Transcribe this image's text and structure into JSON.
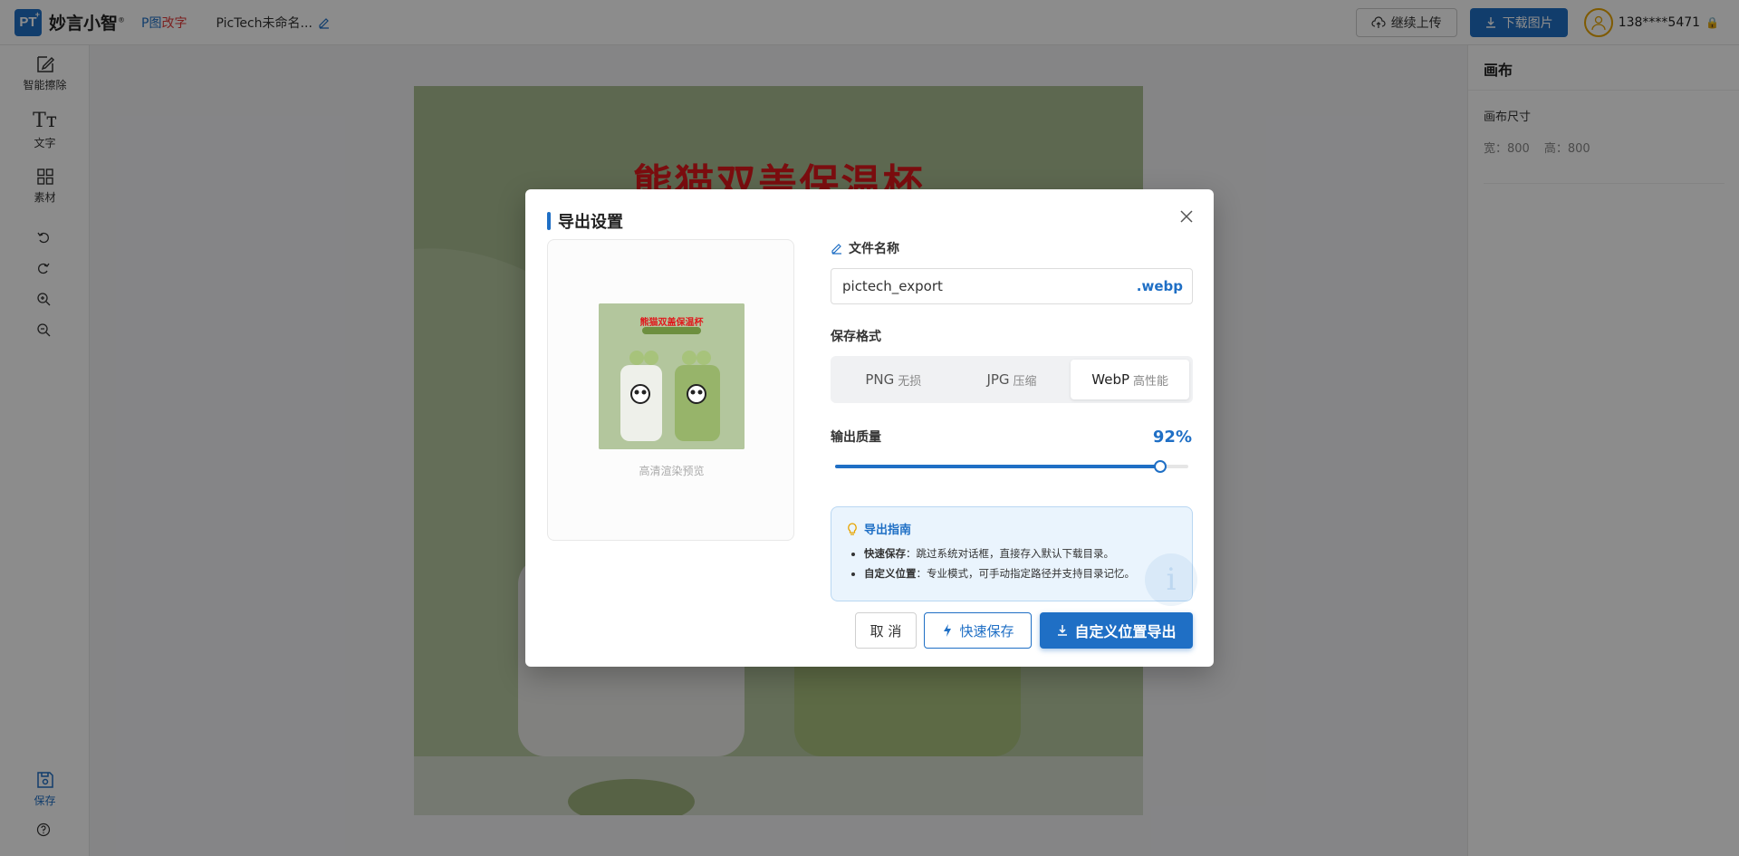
{
  "app": {
    "logo_text": "PT",
    "logo_sup": "+",
    "brand": "妙言小智",
    "brand_mark": "®",
    "sub_brand_left": "P图",
    "sub_brand_right": "改字",
    "doc_title": "PicTech未命名...",
    "accent_color": "#1f6fc5"
  },
  "header": {
    "upload_label": "继续上传",
    "download_label": "下载图片",
    "user_phone": "138****5471"
  },
  "sidebar": {
    "items": [
      {
        "label": "智能擦除",
        "icon": "edit-icon"
      },
      {
        "label": "文字",
        "icon": "text-icon"
      },
      {
        "label": "素材",
        "icon": "grid-icon"
      }
    ],
    "small_tools": [
      "undo-icon",
      "redo-icon",
      "zoom-in-icon",
      "zoom-out-icon"
    ],
    "save_label": "保存",
    "help_icon": "help-icon"
  },
  "canvas": {
    "headline": "熊猫双盖保温杯"
  },
  "panel": {
    "title": "画布",
    "size_label": "画布尺寸",
    "width_label": "宽：800",
    "height_label": "高：800"
  },
  "modal": {
    "title": "导出设置",
    "preview_caption": "高清渲染预览",
    "thumb_title": "熊猫双盖保温杯",
    "filename_label": "文件名称",
    "filename_value": "pictech_export",
    "filename_ext": ".webp",
    "format_label": "保存格式",
    "formats": [
      {
        "name": "PNG",
        "desc": "无损",
        "active": false
      },
      {
        "name": "JPG",
        "desc": "压缩",
        "active": false
      },
      {
        "name": "WebP",
        "desc": "高性能",
        "active": true
      }
    ],
    "quality_label": "输出质量",
    "quality_value": "92%",
    "quality_fraction": 0.92,
    "guide_title": "导出指南",
    "guide_items": [
      {
        "term": "快速保存",
        "text": "：跳过系统对话框，直接存入默认下载目录。"
      },
      {
        "term": "自定义位置",
        "text": "：专业模式，可手动指定路径并支持目录记忆。"
      }
    ],
    "cancel_label": "取 消",
    "quick_save_label": "快速保存",
    "custom_export_label": "自定义位置导出"
  }
}
